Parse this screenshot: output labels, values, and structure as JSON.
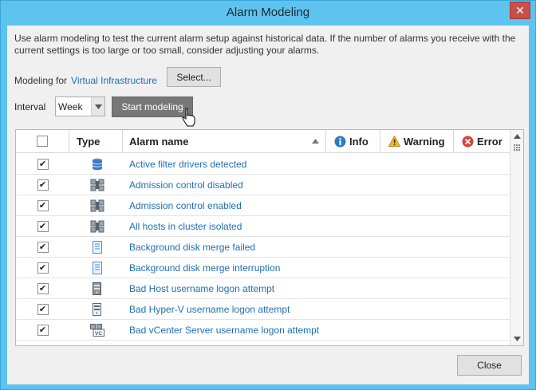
{
  "window": {
    "title": "Alarm Modeling",
    "close_glyph": "✕"
  },
  "description": "Use alarm modeling to test the current alarm setup against historical data. If the number of alarms you receive with the current settings is too large or too small, consider adjusting your alarms.",
  "modeling": {
    "label": "Modeling for",
    "target": "Virtual Infrastructure",
    "select_label": "Select..."
  },
  "interval": {
    "label": "Interval",
    "value": "Week",
    "start_label": "Start modeling"
  },
  "grid": {
    "columns": {
      "type": "Type",
      "name": "Alarm name",
      "info": "Info",
      "warning": "Warning",
      "error": "Error"
    },
    "rows": [
      {
        "checked": true,
        "icon": "datastore-icon",
        "name": "Active filter drivers detected"
      },
      {
        "checked": true,
        "icon": "cluster-icon",
        "name": "Admission control disabled"
      },
      {
        "checked": true,
        "icon": "cluster-icon",
        "name": "Admission control enabled"
      },
      {
        "checked": true,
        "icon": "cluster-icon",
        "name": "All hosts in cluster isolated"
      },
      {
        "checked": true,
        "icon": "vm-icon",
        "name": "Background disk merge failed"
      },
      {
        "checked": true,
        "icon": "vm-icon",
        "name": "Background disk merge interruption"
      },
      {
        "checked": true,
        "icon": "host-icon",
        "name": "Bad Host username logon attempt"
      },
      {
        "checked": true,
        "icon": "hyperv-host-icon",
        "name": "Bad Hyper-V username logon attempt"
      },
      {
        "checked": true,
        "icon": "vcenter-icon",
        "name": "Bad vCenter Server username logon attempt"
      }
    ]
  },
  "footer": {
    "close_label": "Close"
  },
  "colors": {
    "titlebar": "#5ec3ef",
    "link": "#1f6fb3",
    "start_button": "#777777",
    "close_red": "#c7504a"
  }
}
